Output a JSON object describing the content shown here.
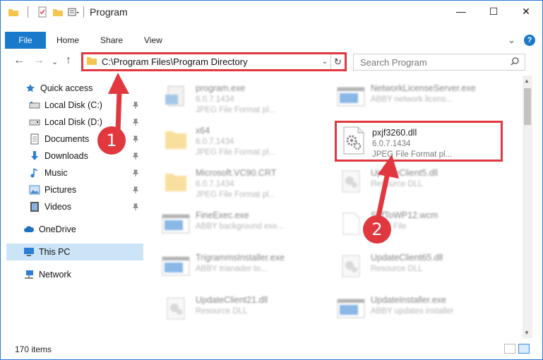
{
  "window": {
    "title": "Program",
    "controls": {
      "minimize": "—",
      "maximize": "☐",
      "close": "✕"
    }
  },
  "ribbon": {
    "file_tab": "File",
    "tabs": [
      "Home",
      "Share",
      "View"
    ],
    "expand": "⌄",
    "help": "?"
  },
  "nav": {
    "back": "←",
    "forward": "→",
    "recent": "⌄",
    "up": "↑",
    "address": "C:\\Program Files\\Program Directory",
    "address_dropdown": "⌄",
    "refresh": "↻",
    "search_placeholder": "Search Program"
  },
  "sidebar": {
    "items": [
      {
        "label": "Quick access",
        "icon": "star-icon"
      },
      {
        "label": "Local Disk (C:)",
        "icon": "drive-icon",
        "pinned": true
      },
      {
        "label": "Local Disk (D:)",
        "icon": "drive-icon",
        "pinned": true
      },
      {
        "label": "Documents",
        "icon": "documents-icon",
        "pinned": true
      },
      {
        "label": "Downloads",
        "icon": "download-icon",
        "pinned": true
      },
      {
        "label": "Music",
        "icon": "music-icon",
        "pinned": true
      },
      {
        "label": "Pictures",
        "icon": "pictures-icon",
        "pinned": true
      },
      {
        "label": "Videos",
        "icon": "videos-icon",
        "pinned": true
      },
      {
        "label": "OneDrive",
        "icon": "cloud-icon"
      },
      {
        "label": "This PC",
        "icon": "computer-icon",
        "selected": true
      },
      {
        "label": "Network",
        "icon": "network-icon"
      }
    ],
    "pin_glyph": "📌"
  },
  "files": [
    {
      "name": "program.exe",
      "line2": "6.0.7.1434",
      "line3": "JPEG File Format pl...",
      "icon": "exe-icon"
    },
    {
      "name": "NetworkLicenseServer.exe",
      "line2": "ABBY network licens...",
      "line3": "",
      "icon": "window-icon"
    },
    {
      "name": "x64",
      "line2": "6.0.7.1434",
      "line3": "JPEG File Format pl...",
      "icon": "folder-icon"
    },
    {
      "name": "Microsoft.VC90.CRT",
      "line2": "6.0.7.1434",
      "line3": "JPEG File Format pl...",
      "icon": "folder-icon"
    },
    {
      "name": "UpdateClient5.dll",
      "line2": "Resource DLL",
      "line3": "",
      "icon": "dll-icon"
    },
    {
      "name": "FineExec.exe",
      "line2": "ABBY background exe...",
      "line3": "",
      "icon": "window-icon"
    },
    {
      "name": "SdfToWP12.wcm",
      "line2": "WCM File",
      "line3": "",
      "icon": "file-icon"
    },
    {
      "name": "TrigrammsInstaller.exe",
      "line2": "ABBY trianader to...",
      "line3": "",
      "icon": "window-icon"
    },
    {
      "name": "UpdateClient65.dll",
      "line2": "Resource DLL",
      "line3": "",
      "icon": "dll-icon"
    },
    {
      "name": "UpdateClient21.dll",
      "line2": "Resource DLL",
      "line3": "",
      "icon": "dll-icon"
    },
    {
      "name": "UpdateInstaller.exe",
      "line2": "ABBY updates installer",
      "line3": "",
      "icon": "window-icon"
    }
  ],
  "highlighted_file": {
    "name": "pxjf3260.dll",
    "version": "6.0.7.1434",
    "description": "JPEG File Format pl...",
    "icon": "dll-gear-icon"
  },
  "status": {
    "count": "170 items"
  },
  "annotations": {
    "step1": "1",
    "step2": "2",
    "color": "#e0383e"
  },
  "colors": {
    "accent": "#1979ca",
    "selected": "#cce4f7",
    "highlight": "#e0383e"
  }
}
